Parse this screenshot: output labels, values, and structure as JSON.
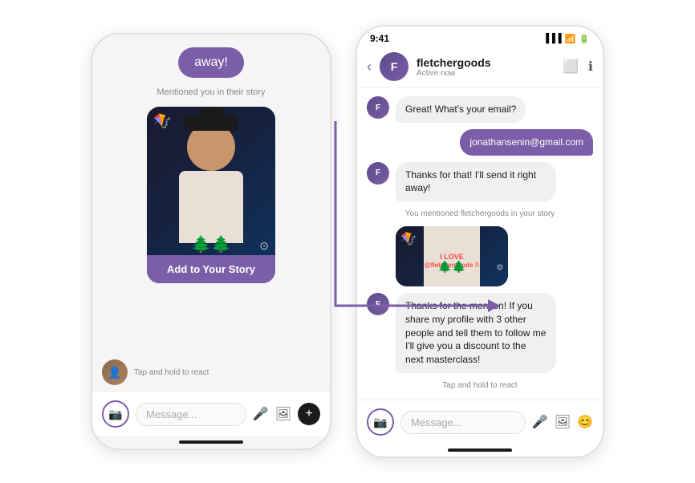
{
  "leftPhone": {
    "topBubble": "away!",
    "mentionLabel": "Mentioned you in their story",
    "addToStoryBtn": "Add to Your Story",
    "tapHold": "Tap and hold to react",
    "messagePlaceholder": "Message...",
    "deco": {
      "top": "🪁",
      "bottom": "⊙",
      "trees": "🌲🌲"
    }
  },
  "rightPhone": {
    "statusTime": "9:41",
    "contactName": "fletchergoods",
    "contactStatus": "Active now",
    "messages": [
      {
        "type": "received",
        "text": "Great! What's your email?"
      },
      {
        "type": "sent",
        "text": "jonathansenin@gmail.com"
      },
      {
        "type": "received",
        "text": "Thanks for that! I'll send it right away!"
      },
      {
        "type": "system",
        "text": "You mentioned fletchergoods in your story"
      },
      {
        "type": "received",
        "text": "Thanks for the mention! If you share my profile with 3 other people and tell them to follow me I'll give you a discount to the next masterclass!"
      },
      {
        "type": "system",
        "text": "Tap and hold to react"
      }
    ],
    "iLoveText": "I LOVE",
    "atText": "@fletchergoods !!",
    "messagePlaceholder": "Message..."
  },
  "arrow": {
    "color": "#7b5ea7"
  }
}
